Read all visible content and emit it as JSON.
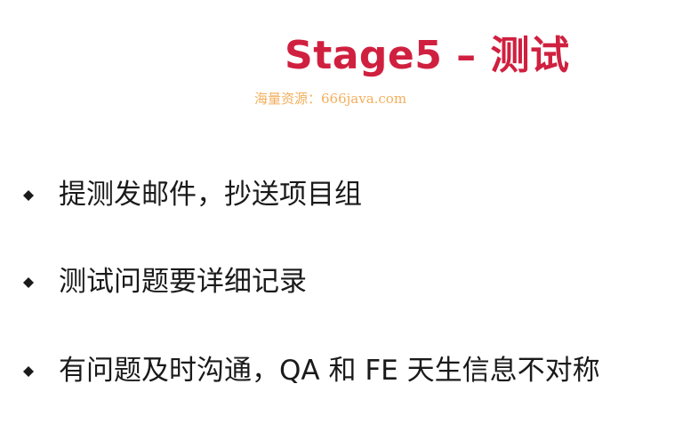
{
  "slide": {
    "title": "Stage5 – 测试",
    "watermark": "海量资源：666java.com",
    "bullets": [
      {
        "icon": "diamond-bullet-icon",
        "text": "提测发邮件，抄送项目组"
      },
      {
        "icon": "diamond-bullet-icon",
        "text": "测试问题要详细记录"
      },
      {
        "icon": "diamond-bullet-icon",
        "text": "有问题及时沟通，QA 和 FE 天生信息不对称"
      }
    ],
    "colors": {
      "title": "#d0203f",
      "watermark": "#f2a64a",
      "text": "#1a1a1a",
      "background": "#ffffff"
    }
  }
}
